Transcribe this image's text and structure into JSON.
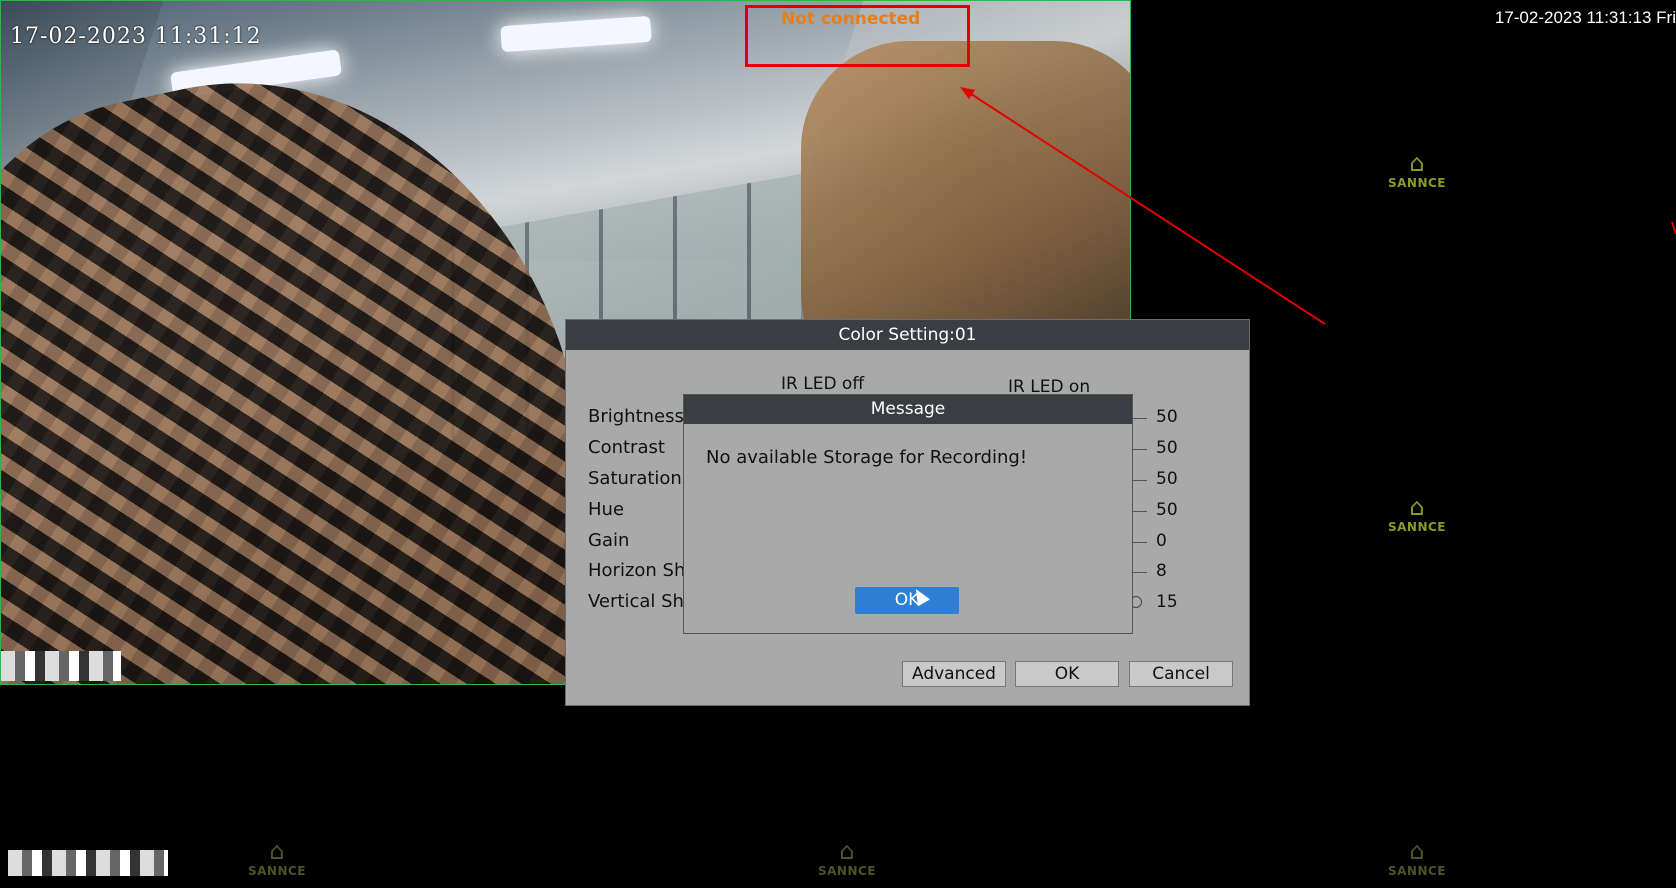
{
  "camera": {
    "timestamp": "17-02-2023  11:31:12",
    "status": "Not connected"
  },
  "system_timestamp": "17-02-2023 11:31:13 Fri",
  "brand": "SANNCE",
  "color_setting": {
    "title": "Color Setting:01",
    "col_ir_off": "IR LED off",
    "col_ir_on": "IR LED on",
    "rows": [
      {
        "label": "Brightness",
        "value": "50"
      },
      {
        "label": "Contrast",
        "value": "50"
      },
      {
        "label": "Saturation",
        "value": "50"
      },
      {
        "label": "Hue",
        "value": "50"
      },
      {
        "label": "Gain",
        "value": "0"
      },
      {
        "label": "Horizon Sh",
        "value": "8"
      },
      {
        "label": "Vertical Sh",
        "value": "15"
      }
    ],
    "buttons": {
      "advanced": "Advanced",
      "ok": "OK",
      "cancel": "Cancel"
    }
  },
  "message": {
    "title": "Message",
    "text": "No available Storage for Recording!",
    "ok": "OK"
  },
  "colors": {
    "accent": "#2d7fd3",
    "alert": "#e10000",
    "status_text": "#e67e1c",
    "tile_border": "#2fb54a"
  }
}
